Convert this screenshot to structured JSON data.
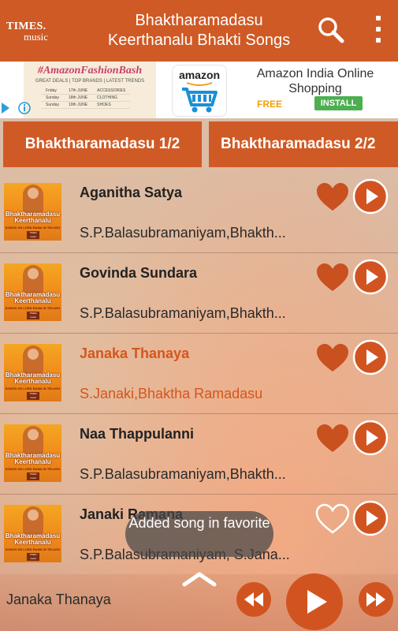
{
  "header": {
    "logo_line1": "TIMES.",
    "logo_line2": "music",
    "title_line1": "Bhaktharamadasu",
    "title_line2": "Keerthanalu Bhakti Songs"
  },
  "ad": {
    "banner_heading": "#AmazonFashionBash",
    "banner_deals": "GREAT DEALS | TOP BRANDS | LATEST TRENDS",
    "banner_rows": [
      [
        "Friday",
        "17th JUNE",
        "ACCESSORIES"
      ],
      [
        "Sunday",
        "18th JUNE",
        "CLOTHING"
      ],
      [
        "Sunday",
        "19th JUNE",
        "SHOES"
      ]
    ],
    "brand_word": "amazon",
    "app_name": "Amazon India Online Shopping",
    "price": "FREE",
    "install_label": "INSTALL"
  },
  "tabs": [
    {
      "label": "Bhaktharamadasu 1/2"
    },
    {
      "label": "Bhaktharamadasu 2/2"
    }
  ],
  "thumbnail": {
    "title": "Bhaktharamadasu Keerthanalu",
    "subtitle": "SONGS ON LORD RAMA IN TELUGU",
    "logo": "TIMES music"
  },
  "songs": [
    {
      "title": "Aganitha Satya",
      "artist": "S.P.Balasubramaniyam,Bhakth...",
      "favorite": true,
      "active": false
    },
    {
      "title": "Govinda Sundara",
      "artist": "S.P.Balasubramaniyam,Bhakth...",
      "favorite": true,
      "active": false
    },
    {
      "title": "Janaka Thanaya",
      "artist": "S.Janaki,Bhaktha Ramadasu",
      "favorite": true,
      "active": true
    },
    {
      "title": "Naa Thappulanni",
      "artist": "S.P.Balasubramaniyam,Bhakth...",
      "favorite": true,
      "active": false
    },
    {
      "title": "Janaki Ramana",
      "artist": "S.P.Balasubramaniyam, S.Jana...",
      "favorite": false,
      "active": false
    }
  ],
  "player": {
    "now_playing": "Janaka Thanaya"
  },
  "toast": {
    "message": "Added song in favorite"
  },
  "colors": {
    "accent": "#cf5a25",
    "active_text": "#d4561c",
    "heart": "#c9501f"
  }
}
